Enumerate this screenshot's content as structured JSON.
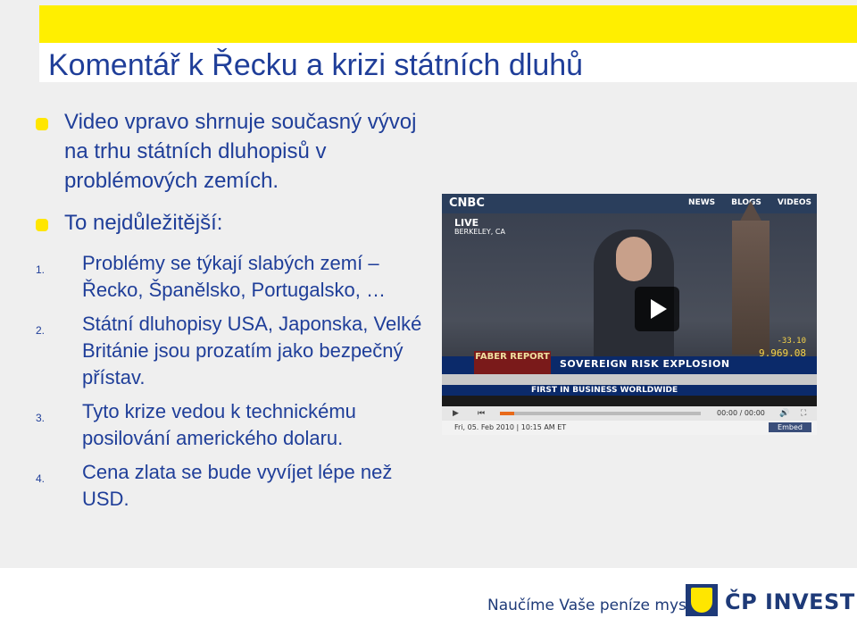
{
  "slide": {
    "title": "Komentář k Řecku a krizi státních dluhů",
    "bullets": [
      "Video vpravo shrnuje současný vývoj na trhu státních dluhopisů v problémových zemích.",
      "To nejdůležitější:"
    ],
    "numbered": [
      {
        "num": "1.",
        "text": "Problémy se týkají slabých zemí – Řecko, Španělsko, Portugalsko, …"
      },
      {
        "num": "2.",
        "text": "Státní dluhopisy USA, Japonska, Velké Británie jsou prozatím jako bezpečný přístav."
      },
      {
        "num": "3.",
        "text": "Tyto krize vedou k technickému posilování amerického dolaru."
      },
      {
        "num": "4.",
        "text": "Cena zlata se bude vyvíjet lépe než USD."
      }
    ]
  },
  "video": {
    "logo": "CNBC",
    "nav": [
      "NEWS",
      "BLOGS",
      "VIDEOS"
    ],
    "live": "LIVE",
    "location": "BERKELEY, CA",
    "ticker_change": "-33.10",
    "ticker_value": "9,969.08",
    "faber": "FABER REPORT",
    "headline": "SOVEREIGN RISK EXPLOSION",
    "subline": "FIRST IN BUSINESS WORLDWIDE",
    "time": "00:00 / 00:00",
    "progress": 0.07,
    "date": "Fri, 05. Feb 2010 | 10:15 AM ET",
    "embed": "Embed"
  },
  "footer": {
    "slogan": "Naučíme Vaše peníze myslet",
    "brand": "ČP INVEST"
  },
  "colors": {
    "accent_yellow": "#ffef00",
    "text_blue": "#1f3e99",
    "brand_blue": "#1e3a78"
  }
}
